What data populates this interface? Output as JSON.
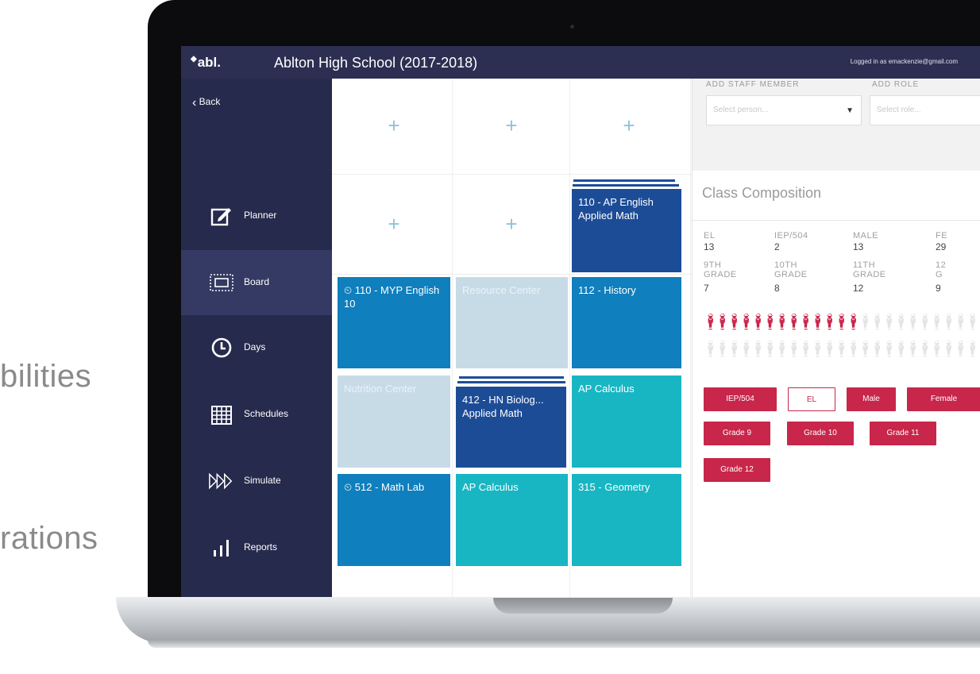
{
  "background_text": [
    "bilities",
    "rations"
  ],
  "app": {
    "logo": "abl.",
    "school": "Ablton High School (2017-2018)",
    "logged_in": "Logged in as emackenzie@gmail.com"
  },
  "sidebar": {
    "back": "Back",
    "items": [
      {
        "label": "Planner",
        "icon": "pencil-square-icon"
      },
      {
        "label": "Board",
        "icon": "board-icon",
        "active": true
      },
      {
        "label": "Days",
        "icon": "clock-icon"
      },
      {
        "label": "Schedules",
        "icon": "calendar-grid-icon"
      },
      {
        "label": "Simulate",
        "icon": "fast-forward-icon"
      },
      {
        "label": "Reports",
        "icon": "bar-chart-icon"
      }
    ]
  },
  "board": {
    "add_symbol": "+",
    "cells": {
      "r2c3": "110 - AP English Applied Math",
      "r3c1": "110 - MYP English 10",
      "r3c2": "Resource Center",
      "r3c3": "112 - History",
      "r4c1": "Nutrition Center",
      "r4c2": "412 - HN Biolog... Applied Math",
      "r4c3": "AP Calculus",
      "r5c1": "512 - Math Lab",
      "r5c2": "AP Calculus",
      "r5c3": "315 - Geometry"
    },
    "clock_glyph": "⏲"
  },
  "panel": {
    "add_staff_label": "ADD STAFF MEMBER",
    "add_role_label": "ADD ROLE",
    "select_person_placeholder": "Select person...",
    "select_role_placeholder": "Select role...",
    "composition_title": "Class Composition",
    "stats_row1": [
      {
        "label": "EL",
        "value": "13"
      },
      {
        "label": "IEP/504",
        "value": "2"
      },
      {
        "label": "MALE",
        "value": "13"
      },
      {
        "label": "FE",
        "value": "29"
      }
    ],
    "stats_row2": [
      {
        "label": "9TH\nGRADE",
        "value": "7"
      },
      {
        "label": "10TH\nGRADE",
        "value": "8"
      },
      {
        "label": "11TH\nGRADE",
        "value": "12"
      },
      {
        "label": "12\nG",
        "value": "9"
      }
    ],
    "tags_row1": [
      "IEP/504",
      "EL",
      "Male",
      "Female"
    ],
    "tags_row2": [
      "Grade 9",
      "Grade 10",
      "Grade 11"
    ],
    "tags_row3": [
      "Grade 12"
    ],
    "accent_color": "#c8264a"
  }
}
